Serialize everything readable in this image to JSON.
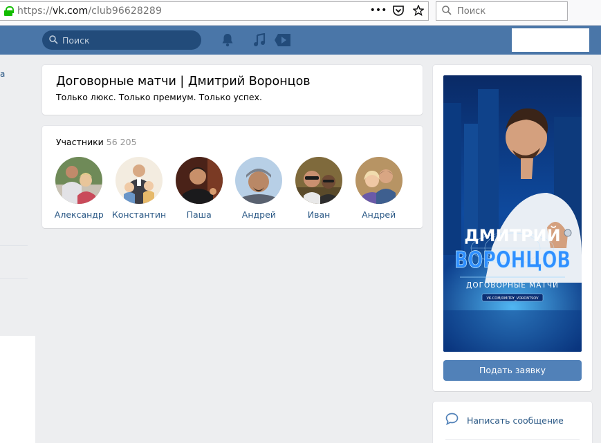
{
  "browser": {
    "url_prefix": "https://",
    "url_domain": "vk.com",
    "url_path": "/club96628289",
    "search_placeholder": "Поиск"
  },
  "header": {
    "search_placeholder": "Поиск",
    "icons": [
      "bell-icon",
      "music-icon",
      "video-icon"
    ]
  },
  "sidebar": {
    "link_fragment": "а"
  },
  "group": {
    "title": "Договорные матчи | Дмитрий Воронцов",
    "status": "Только люкс. Только премиум. Только успех."
  },
  "members": {
    "label": "Участники",
    "count": "56 205",
    "items": [
      {
        "name": "Александр"
      },
      {
        "name": "Константин"
      },
      {
        "name": "Паша"
      },
      {
        "name": "Андрей"
      },
      {
        "name": "Иван"
      },
      {
        "name": "Андрей"
      }
    ]
  },
  "cover": {
    "title_line1": "ДМИТРИЙ",
    "title_line2": "ВОРОНЦОВ",
    "subtitle": "ДОГОВОРНЫЕ МАТЧИ",
    "link": "VK.COM/DMITRY_VORONTSOV"
  },
  "actions": {
    "join_label": "Подать заявку",
    "message_label": "Написать сообщение"
  },
  "colors": {
    "header_bg": "#4a76a8",
    "link": "#2a5885",
    "button": "#5181b8",
    "page_bg": "#edeef0"
  }
}
